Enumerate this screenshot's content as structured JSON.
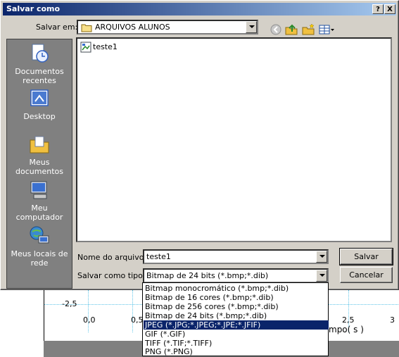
{
  "window": {
    "title": "Salvar como",
    "help_btn": "?",
    "close_btn": "X"
  },
  "save_in": {
    "label": "Salvar em:",
    "value": "ARQUIVOS ALUNOS"
  },
  "toolbar": {
    "icons": [
      "back-icon",
      "up-folder-icon",
      "new-folder-icon",
      "view-menu-icon"
    ]
  },
  "places": [
    {
      "label": "Documentos recentes",
      "icon": "recent-documents-icon"
    },
    {
      "label": "Desktop",
      "icon": "desktop-icon"
    },
    {
      "label": "Meus documentos",
      "icon": "my-documents-icon"
    },
    {
      "label": "Meu computador",
      "icon": "my-computer-icon"
    },
    {
      "label": "Meus locais de rede",
      "icon": "network-places-icon"
    }
  ],
  "files": [
    {
      "name": "teste1",
      "icon": "bitmap-file-icon"
    }
  ],
  "filename": {
    "label": "Nome do arquivo:",
    "value": "teste1"
  },
  "filetype": {
    "label": "Salvar como tipo:",
    "value": "Bitmap de 24 bits (*.bmp;*.dib)",
    "options": [
      "Bitmap monocromático (*.bmp;*.dib)",
      "Bitmap de 16 cores (*.bmp;*.dib)",
      "Bitmap de 256 cores (*.bmp;*.dib)",
      "Bitmap de 24 bits (*.bmp;*.dib)",
      "JPEG (*.JPG;*.JPEG;*.JPE;*.JFIF)",
      "GIF (*.GIF)",
      "TIFF (*.TIF;*.TIFF)",
      "PNG (*.PNG)"
    ],
    "highlighted_index": 4
  },
  "buttons": {
    "save": "Salvar",
    "cancel": "Cancelar"
  },
  "background_chart": {
    "y_tick": "-2,5",
    "x_ticks": [
      "0,0",
      "0,5",
      "2,5",
      "3"
    ],
    "x_label_fragment": "mpo( s )"
  }
}
